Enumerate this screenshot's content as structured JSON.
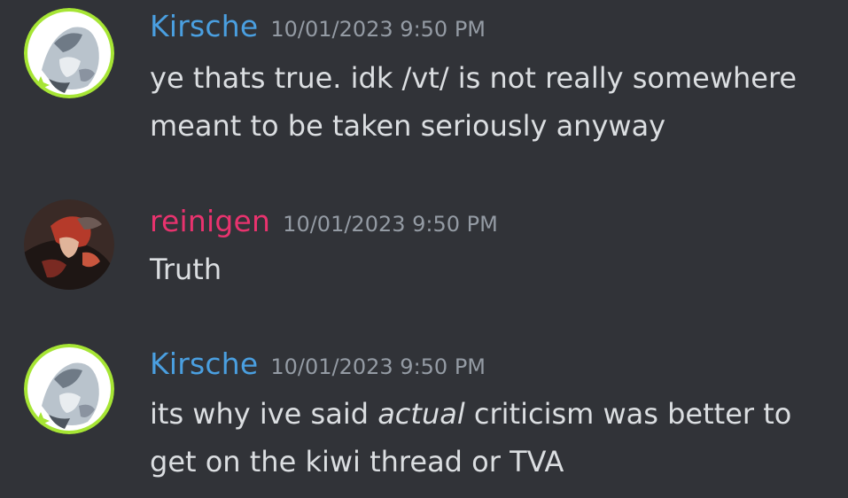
{
  "colors": {
    "background": "#313338",
    "text": "#dbdee1",
    "timestamp": "#949ba4",
    "kirsche": "#4a9fe0",
    "reinigen": "#e8336e",
    "avatar_ring": "#a6e534"
  },
  "messages": [
    {
      "author": "Kirsche",
      "avatar": "kirsche-avatar",
      "timestamp": "10/01/2023 9:50 PM",
      "text": "ye thats true. idk /vt/ is not really somewhere meant to be taken seriously anyway"
    },
    {
      "author": "reinigen",
      "avatar": "reinigen-avatar",
      "timestamp": "10/01/2023 9:50 PM",
      "text": "Truth"
    },
    {
      "author": "Kirsche",
      "avatar": "kirsche-avatar",
      "timestamp": "10/01/2023 9:50 PM",
      "text_before": "its why ive said ",
      "text_emphasis": "actual",
      "text_after": " criticism was better to get on the kiwi thread or TVA"
    }
  ]
}
